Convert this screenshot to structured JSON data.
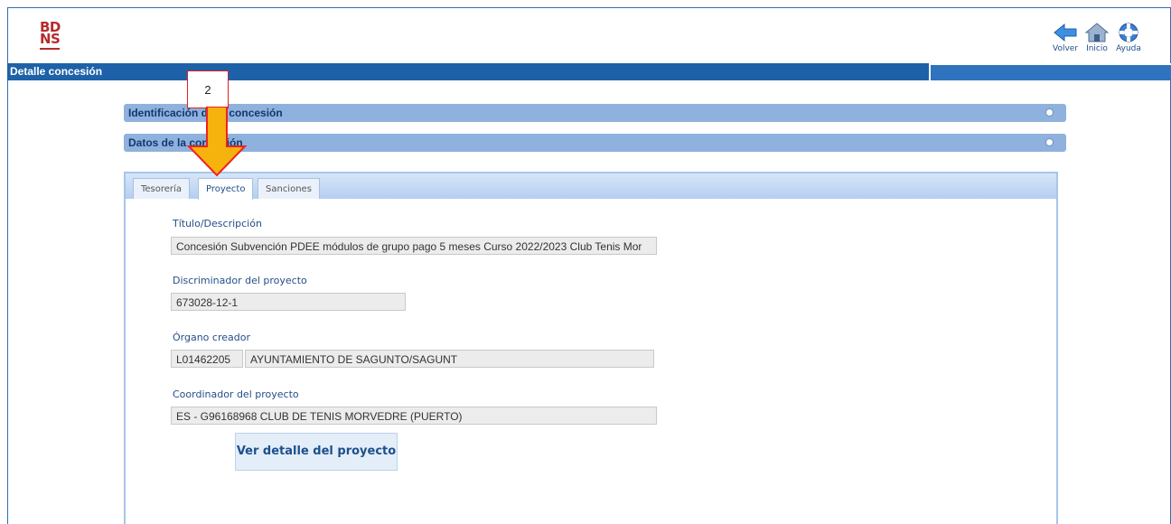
{
  "logo": {
    "line1": "BD",
    "line2": "NS"
  },
  "toolbar": {
    "back_label": "Volver",
    "home_label": "Inicio",
    "help_label": "Ayuda"
  },
  "page": {
    "title": "Detalle concesión"
  },
  "sections": {
    "identificacion": "Identificación de la concesión",
    "datos": "Datos de la concesión"
  },
  "tabs": {
    "tesoreria": "Tesorería",
    "proyecto": "Proyecto",
    "sanciones": "Sanciones"
  },
  "form": {
    "titulo_label": "Título/Descripción",
    "titulo_value": "Concesión Subvención PDEE módulos de grupo pago 5 meses Curso 2022/2023 Club Tenis Mor",
    "discriminador_label": "Discriminador del proyecto",
    "discriminador_value": "673028-12-1",
    "organo_label": "Órgano creador",
    "organo_code": "L01462205",
    "organo_name": "AYUNTAMIENTO DE SAGUNTO/SAGUNT",
    "coordinador_label": "Coordinador del proyecto",
    "coordinador_value": "ES - G96168968 CLUB DE TENIS MORVEDRE (PUERTO)"
  },
  "buttons": {
    "ver_detalle": "Ver detalle del proyecto"
  },
  "annotation": {
    "callout_number": "2"
  }
}
